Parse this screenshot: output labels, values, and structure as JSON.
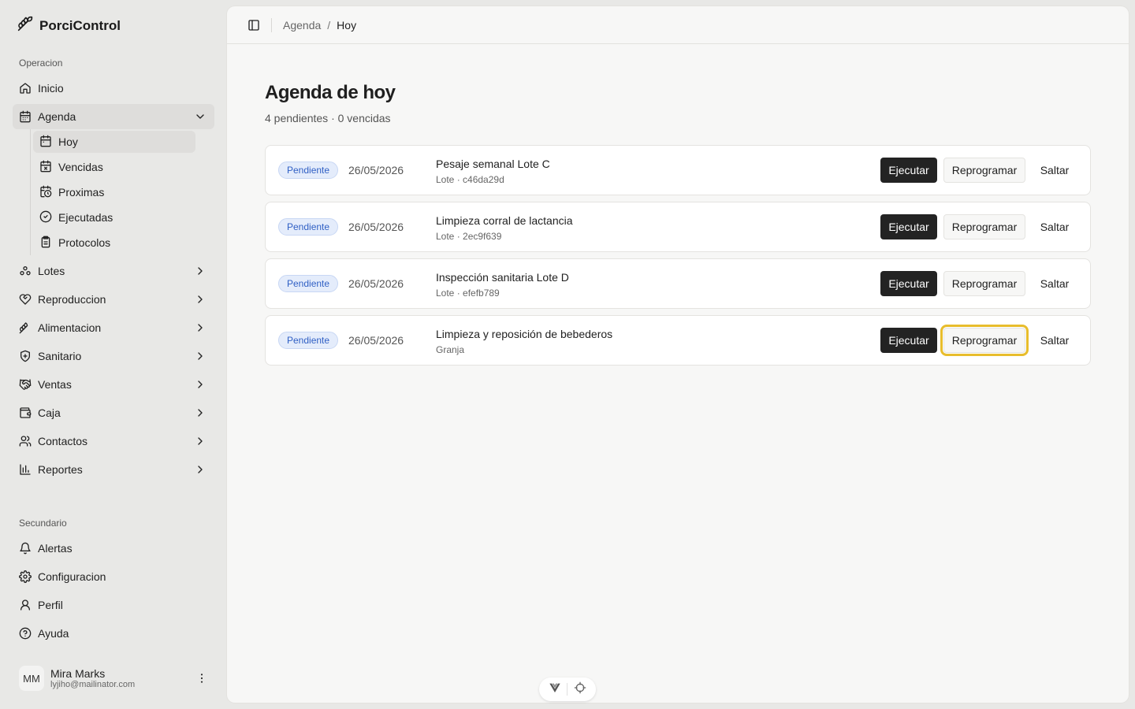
{
  "app": {
    "name": "PorciControl"
  },
  "sidebar": {
    "sections": {
      "primary": "Operacion",
      "secondary": "Secundario"
    },
    "items": [
      {
        "label": "Inicio",
        "icon": "home-icon"
      },
      {
        "label": "Agenda",
        "icon": "calendar-icon",
        "expanded": true
      },
      {
        "label": "Lotes",
        "icon": "group-icon"
      },
      {
        "label": "Reproduccion",
        "icon": "heart-icon"
      },
      {
        "label": "Alimentacion",
        "icon": "wheat-icon"
      },
      {
        "label": "Sanitario",
        "icon": "shield-icon"
      },
      {
        "label": "Ventas",
        "icon": "handshake-icon"
      },
      {
        "label": "Caja",
        "icon": "wallet-icon"
      },
      {
        "label": "Contactos",
        "icon": "users-icon"
      },
      {
        "label": "Reportes",
        "icon": "bar-chart-icon"
      }
    ],
    "agenda_sub": [
      {
        "label": "Hoy",
        "icon": "calendar-icon"
      },
      {
        "label": "Vencidas",
        "icon": "calendar-x-icon"
      },
      {
        "label": "Proximas",
        "icon": "calendar-clock-icon"
      },
      {
        "label": "Ejecutadas",
        "icon": "check-circle-icon"
      },
      {
        "label": "Protocolos",
        "icon": "clipboard-icon"
      }
    ],
    "secondary_items": [
      {
        "label": "Alertas",
        "icon": "bell-icon"
      },
      {
        "label": "Configuracion",
        "icon": "gear-icon"
      },
      {
        "label": "Perfil",
        "icon": "user-icon"
      },
      {
        "label": "Ayuda",
        "icon": "help-icon"
      }
    ],
    "user": {
      "initials": "MM",
      "name": "Mira Marks",
      "email": "lyjiho@mailinator.com"
    }
  },
  "breadcrumb": {
    "parent": "Agenda",
    "separator": "/",
    "current": "Hoy"
  },
  "page": {
    "title": "Agenda de hoy",
    "subtitle": "4 pendientes · 0 vencidas"
  },
  "actions": {
    "execute": "Ejecutar",
    "reschedule": "Reprogramar",
    "skip": "Saltar"
  },
  "tasks": [
    {
      "status": "Pendiente",
      "date": "26/05/2026",
      "title": "Pesaje semanal Lote C",
      "meta": "Lote · c46da29d"
    },
    {
      "status": "Pendiente",
      "date": "26/05/2026",
      "title": "Limpieza corral de lactancia",
      "meta": "Lote · 2ec9f639"
    },
    {
      "status": "Pendiente",
      "date": "26/05/2026",
      "title": "Inspección sanitaria Lote D",
      "meta": "Lote · efefb789"
    },
    {
      "status": "Pendiente",
      "date": "26/05/2026",
      "title": "Limpieza y reposición de bebederos",
      "meta": "Granja"
    }
  ],
  "colors": {
    "badge_bg": "#e4ecfb",
    "badge_text": "#2f5fc4",
    "primary_button": "#232323",
    "focus_ring": "#e8bd2c"
  }
}
